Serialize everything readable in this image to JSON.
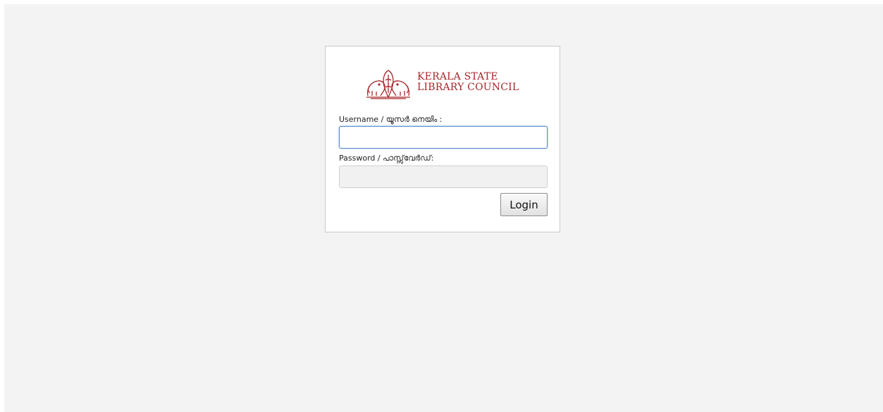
{
  "logo": {
    "line1": "KERALA STATE",
    "line2": "LIBRARY COUNCIL",
    "brand_color": "#a8272a",
    "icon": "kerala-emblem-icon"
  },
  "form": {
    "username_label": "Username / യൂസർ നെയിം :",
    "username_value": "",
    "password_label": "Password / പാസ്സ്‌വേർഡ്:",
    "password_value": "",
    "login_button": "Login"
  },
  "colors": {
    "page_background": "#f3f3f3",
    "focus_border": "#5f8cc9"
  }
}
